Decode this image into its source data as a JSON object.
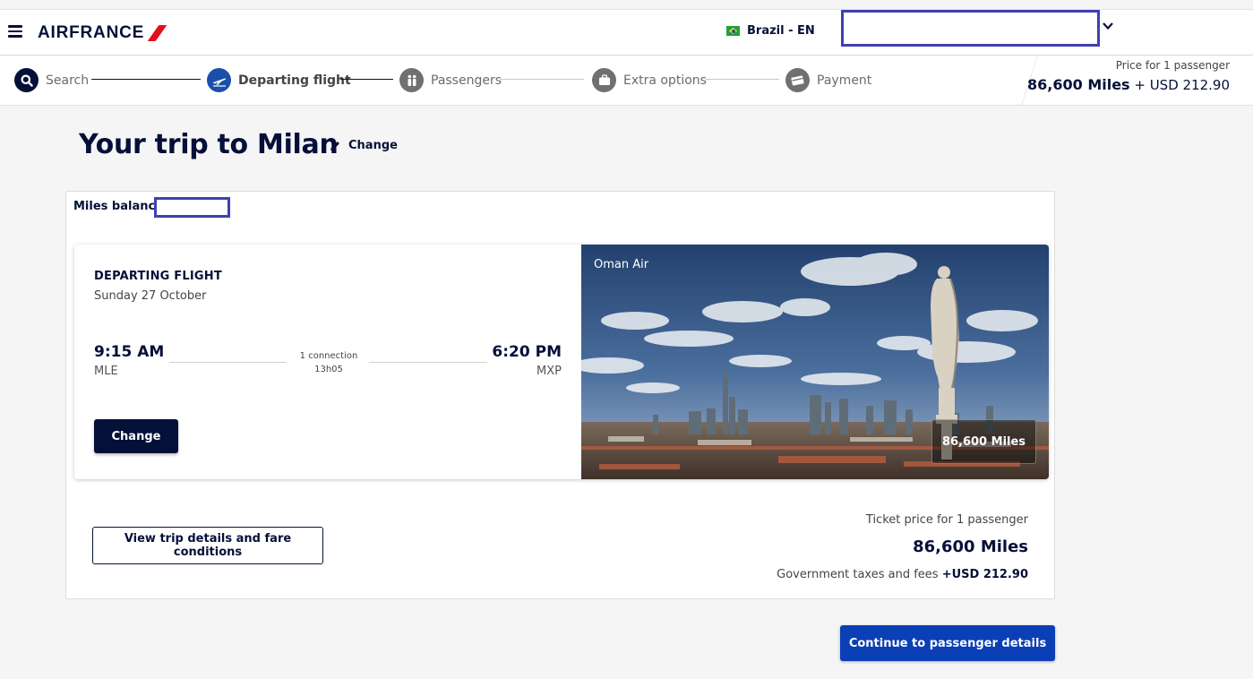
{
  "header": {
    "logo_text": "AIRFRANCE",
    "locale": "Brazil - EN",
    "menu_icon": "hamburger-icon",
    "chevron_icon": "chevron-down-icon"
  },
  "stepper": {
    "steps": [
      {
        "label": "Search",
        "icon": "search-icon",
        "state": "done"
      },
      {
        "label": "Departing flight",
        "icon": "airplane-icon",
        "state": "active"
      },
      {
        "label": "Passengers",
        "icon": "passengers-icon",
        "state": "pending"
      },
      {
        "label": "Extra options",
        "icon": "suitcase-icon",
        "state": "pending"
      },
      {
        "label": "Payment",
        "icon": "credit-card-icon",
        "state": "pending"
      }
    ],
    "price_label": "Price for 1 passenger",
    "price_miles": "86,600 Miles",
    "price_usd": "+ USD 212.90"
  },
  "page": {
    "title": "Your trip to Milan",
    "change_label": "Change"
  },
  "card": {
    "miles_balance_label": "Miles balance",
    "flight": {
      "label": "DEPARTING FLIGHT",
      "date": "Sunday 27 October",
      "departure_time": "9:15 AM",
      "departure_code": "MLE",
      "arrival_time": "6:20 PM",
      "arrival_code": "MXP",
      "connection": "1 connection",
      "duration": "13h05",
      "change_button": "Change",
      "airline": "Oman Air",
      "miles_badge": "86,600 Miles"
    },
    "details_button": "View trip details and fare conditions",
    "ticket_label": "Ticket price for 1 passenger",
    "ticket_miles": "86,600 Miles",
    "tax_label": "Government taxes and fees",
    "tax_value": "+USD 212.90"
  },
  "continue_button": "Continue to passenger details",
  "colors": {
    "brand_navy": "#051039",
    "brand_red": "#e3101a",
    "active_step": "#1b4fa8",
    "primary_button": "#0b3fb5",
    "redaction": "#3f3fb4"
  }
}
